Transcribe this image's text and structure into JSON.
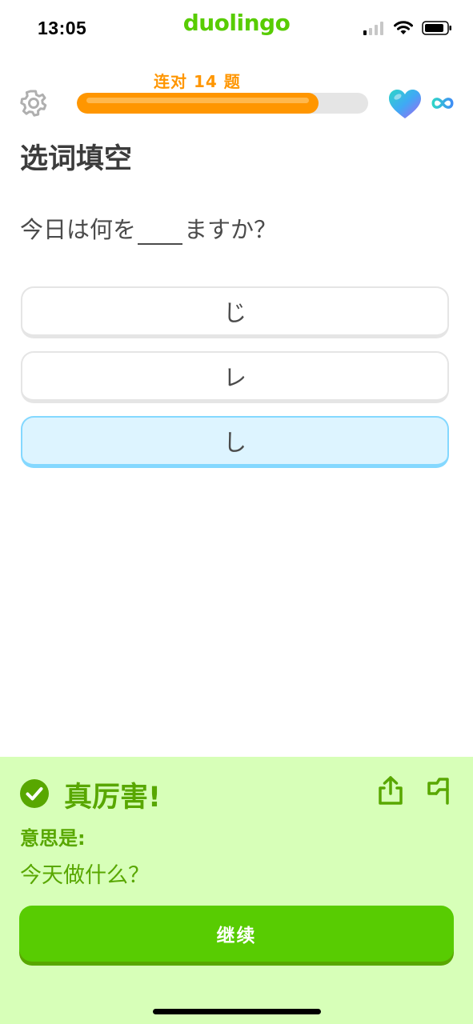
{
  "status_bar": {
    "time": "13:05",
    "brand": "duolingo"
  },
  "header": {
    "streak_label": "连对 14 题",
    "progress_fraction": 0.83
  },
  "prompt": {
    "title": "选词填空",
    "sentence_before": "今日は何を",
    "sentence_after": "ますか？"
  },
  "options": [
    {
      "label": "じ",
      "selected": false
    },
    {
      "label": "レ",
      "selected": false
    },
    {
      "label": "し",
      "selected": true
    }
  ],
  "feedback": {
    "title": "真厉害!",
    "meaning_label": "意思是:",
    "meaning_text": "今天做什么？",
    "continue_label": "继续"
  },
  "colors": {
    "brand_green": "#58cc02",
    "streak_orange": "#ff9600",
    "feedback_bg": "#d7ffb8",
    "feedback_text": "#58a700",
    "selected_bg": "#ddf4ff",
    "selected_border": "#84d8ff"
  },
  "icons": [
    "signal-icon",
    "wifi-icon",
    "battery-icon",
    "gear-icon",
    "heart-icon",
    "infinity-icon",
    "check-circle-icon",
    "share-icon",
    "flag-icon"
  ]
}
